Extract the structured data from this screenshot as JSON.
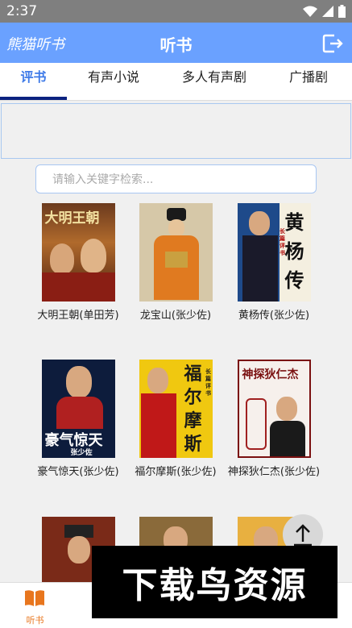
{
  "status": {
    "time": "2:37"
  },
  "app_bar": {
    "brand": "熊猫听书",
    "title": "听书"
  },
  "tabs": [
    {
      "label": "评书",
      "active": true
    },
    {
      "label": "有声小说",
      "active": false
    },
    {
      "label": "多人有声剧",
      "active": false
    },
    {
      "label": "广播剧",
      "active": false
    }
  ],
  "search": {
    "placeholder": "请输入关键字检索..."
  },
  "books": [
    {
      "title": "大明王朝(单田芳)",
      "cover_text": "大明王朝",
      "cover_icon": "portrait-cover"
    },
    {
      "title": "龙宝山(张少佐)",
      "cover_text": "",
      "cover_icon": "official-portrait-cover"
    },
    {
      "title": "黄杨传(张少佐)",
      "cover_text": "黄杨传",
      "cover_sub": "长篇评书",
      "cover_icon": "performer-cover"
    },
    {
      "title": "豪气惊天(张少佐)",
      "cover_text": "豪气惊天",
      "cover_sub": "张少佐",
      "cover_icon": "performer-cover"
    },
    {
      "title": "福尔摩斯(张少佐)",
      "cover_text": "福尔摩斯",
      "cover_sub": "长篇评书",
      "cover_icon": "performer-cover"
    },
    {
      "title": "神探狄仁杰(张少佐)",
      "cover_text": "神探狄仁杰",
      "cover_icon": "performer-cover"
    },
    {
      "title": "",
      "cover_icon": "portrait-cover"
    },
    {
      "title": "",
      "cover_icon": "performer-cover"
    },
    {
      "title": "",
      "cover_icon": "performer-cover"
    }
  ],
  "watermark": "下载鸟资源",
  "bottom_nav": [
    {
      "label": "听书",
      "icon": "book-icon",
      "active": true
    },
    {
      "label": "",
      "icon": "",
      "active": false
    },
    {
      "label": "",
      "icon": "",
      "active": false
    },
    {
      "label": "",
      "icon": "",
      "active": false
    },
    {
      "label": "",
      "icon": "",
      "active": false
    }
  ],
  "colors": {
    "app_bar": "#6aa1ff",
    "tab_active": "#3f7be8",
    "indicator": "#0b2280",
    "nav_active": "#e8761e"
  }
}
